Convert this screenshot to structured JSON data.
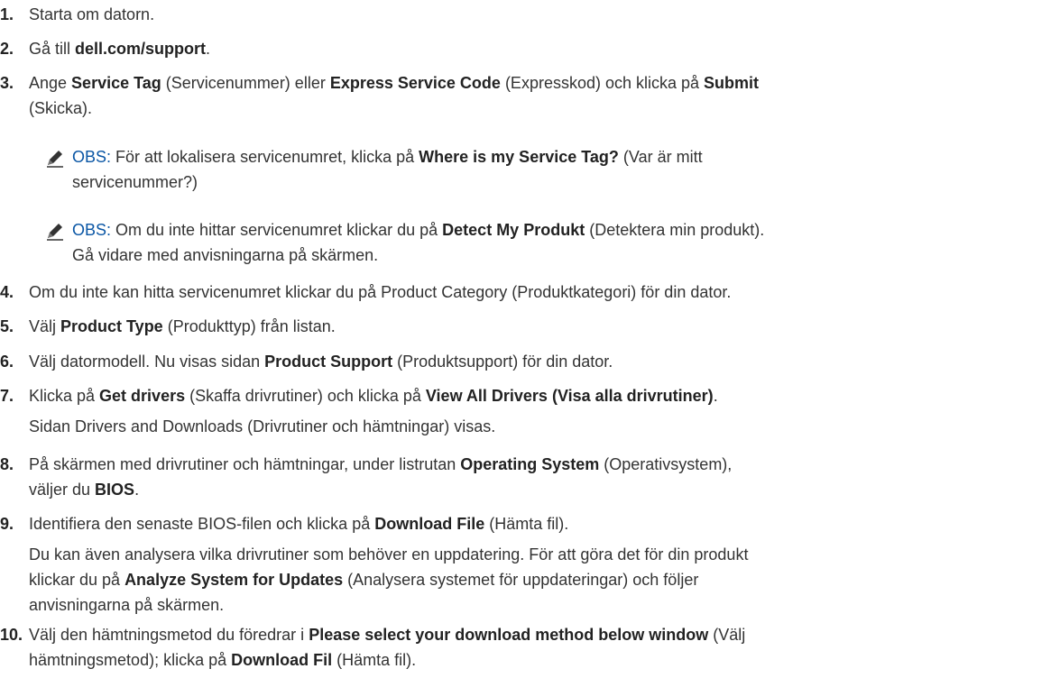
{
  "steps": [
    {
      "num": "1.",
      "parts": [
        {
          "t": "Starta om datorn."
        }
      ]
    },
    {
      "num": "2.",
      "parts": [
        {
          "t": "Gå till "
        },
        {
          "b": "dell.com/support"
        },
        {
          "t": "."
        }
      ]
    },
    {
      "num": "3.",
      "line1": [
        {
          "t": "Ange "
        },
        {
          "b": "Service Tag"
        },
        {
          "t": " (Servicenummer) eller "
        },
        {
          "b": "Express Service Code"
        },
        {
          "t": " (Expresskod) och klicka på "
        },
        {
          "b": "Submit"
        }
      ],
      "line2": [
        {
          "t": "(Skicka)."
        }
      ]
    },
    {
      "num": "4.",
      "parts": [
        {
          "t": "Om du inte kan hitta servicenumret klickar du på Product Category (Produktkategori) för din dator."
        }
      ]
    },
    {
      "num": "5.",
      "parts": [
        {
          "t": "Välj "
        },
        {
          "b": "Product Type"
        },
        {
          "t": " (Produkttyp) från listan."
        }
      ]
    },
    {
      "num": "6.",
      "parts": [
        {
          "t": "Välj datormodell. Nu visas sidan "
        },
        {
          "b": "Product Support"
        },
        {
          "t": " (Produktsupport) för din dator."
        }
      ]
    },
    {
      "num": "7.",
      "line1": [
        {
          "t": "Klicka på "
        },
        {
          "b": "Get drivers"
        },
        {
          "t": " (Skaffa drivrutiner) och klicka på "
        },
        {
          "b": "View All Drivers (Visa alla drivrutiner)"
        },
        {
          "t": "."
        }
      ],
      "line2": [
        {
          "t": "Sidan Drivers and Downloads (Drivrutiner och hämtningar) visas."
        }
      ]
    },
    {
      "num": "8.",
      "line1": [
        {
          "t": "På skärmen med drivrutiner och hämtningar, under listrutan "
        },
        {
          "b": "Operating System"
        },
        {
          "t": " (Operativsystem),"
        }
      ],
      "line2": [
        {
          "t": "väljer du "
        },
        {
          "b": "BIOS"
        },
        {
          "t": "."
        }
      ]
    },
    {
      "num": "9.",
      "line1": [
        {
          "t": "Identifiera den senaste BIOS-filen och klicka på "
        },
        {
          "b": "Download File"
        },
        {
          "t": " (Hämta fil)."
        }
      ],
      "para": [
        [
          {
            "t": "Du kan även analysera vilka drivrutiner som behöver en uppdatering. För att göra det för din produkt"
          }
        ],
        [
          {
            "t": "klickar du på "
          },
          {
            "b": "Analyze System for Updates"
          },
          {
            "t": " (Analysera systemet för uppdateringar) och följer"
          }
        ],
        [
          {
            "t": "anvisningarna på skärmen."
          }
        ]
      ]
    },
    {
      "num": "10.",
      "line1": [
        {
          "t": "Välj den hämtningsmetod du föredrar i "
        },
        {
          "b": "Please select your download method below window"
        },
        {
          "t": " (Välj"
        }
      ],
      "line2": [
        {
          "t": "hämtningsmetod); klicka på "
        },
        {
          "b": "Download Fil"
        },
        {
          "t": " (Hämta fil)."
        }
      ]
    }
  ],
  "notes": [
    {
      "label": "OBS:",
      "line1": [
        {
          "t": " För att lokalisera servicenumret, klicka på "
        },
        {
          "b": "Where is my Service Tag?"
        },
        {
          "t": " (Var är mitt"
        }
      ],
      "line2": [
        {
          "t": "servicenummer?)"
        }
      ]
    },
    {
      "label": "OBS:",
      "line1": [
        {
          "t": " Om du inte hittar servicenumret klickar du på "
        },
        {
          "b": "Detect My Produkt"
        },
        {
          "t": " (Detektera min produkt)."
        }
      ],
      "line2": [
        {
          "t": "Gå vidare med anvisningarna på skärmen."
        }
      ]
    }
  ],
  "icons": {
    "note": "pencil-note-icon"
  }
}
